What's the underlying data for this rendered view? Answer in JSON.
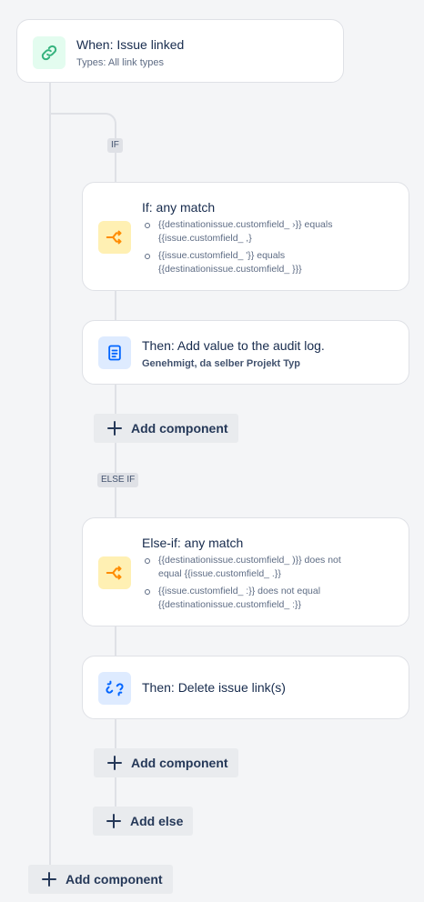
{
  "trigger": {
    "title": "When: Issue linked",
    "subtitle": "Types: All link types",
    "icon": "link-icon"
  },
  "if_badge": "IF",
  "if_condition": {
    "title": "If: any match",
    "icon": "branch-icon",
    "items": [
      {
        "line1": "{{destinationissue.customfield_          ›}} equals",
        "line2": "{{issue.customfield_            ,}"
      },
      {
        "line1": "{{issue.customfield_           '}} equals",
        "line2": "{{destinationissue.customfield_          }}}"
      }
    ]
  },
  "if_action": {
    "title": "Then: Add value to the audit log.",
    "subtitle": "Genehmigt, da selber Projekt Typ",
    "icon": "document-icon"
  },
  "add_component_1": "Add component",
  "elseif_badge": "ELSE IF",
  "elseif_condition": {
    "title": "Else-if: any match",
    "icon": "branch-icon",
    "items": [
      {
        "line1": "{{destinationissue.customfield_          )}} does not",
        "line2": "equal {{issue.customfield_          .}}"
      },
      {
        "line1": "{{issue.customfield_           :}} does not equal",
        "line2": "{{destinationissue.customfield_          :}}"
      }
    ]
  },
  "elseif_action": {
    "title": "Then: Delete issue link(s)",
    "icon": "unlink-icon"
  },
  "add_component_2": "Add component",
  "add_else": "Add else",
  "add_component_3": "Add component",
  "colors": {
    "background": "#f4f5f7",
    "connector": "#dfe1e6",
    "green_icon": "#36b37e",
    "orange_icon": "#ff8b00",
    "blue_icon": "#0065ff"
  }
}
